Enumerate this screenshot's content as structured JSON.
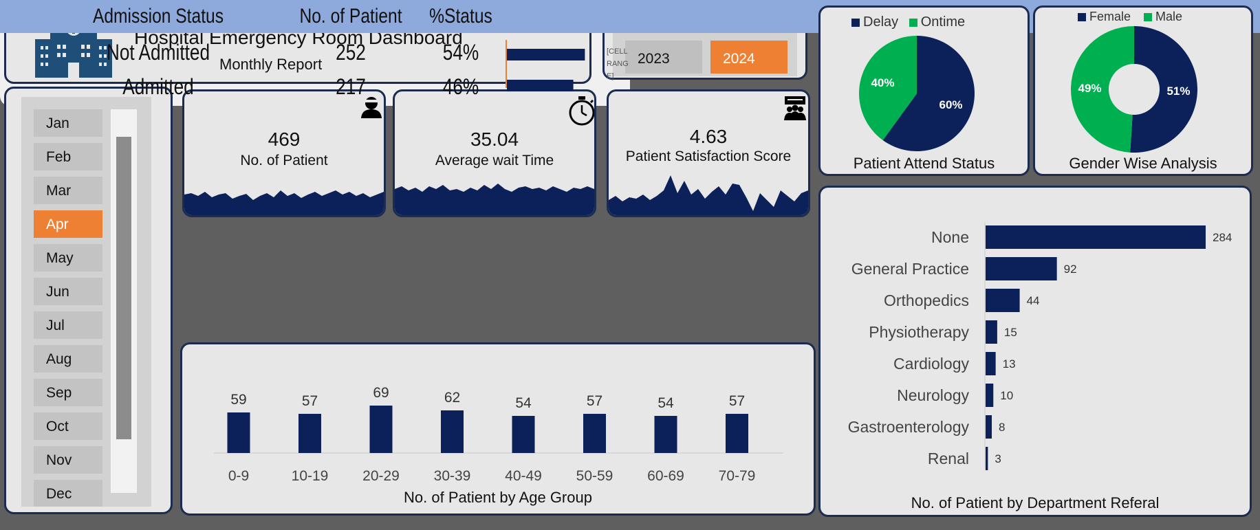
{
  "header": {
    "title": "Hospital Emergency Room Dashboard",
    "subtitle": "Monthly Report",
    "logo_icon": "hospital-icon"
  },
  "years": [
    {
      "label": "2023",
      "selected": false
    },
    {
      "label": "2024",
      "selected": true
    }
  ],
  "months": [
    {
      "label": "Jan",
      "selected": false
    },
    {
      "label": "Feb",
      "selected": false
    },
    {
      "label": "Mar",
      "selected": false
    },
    {
      "label": "Apr",
      "selected": true
    },
    {
      "label": "May",
      "selected": false
    },
    {
      "label": "Jun",
      "selected": false
    },
    {
      "label": "Jul",
      "selected": false
    },
    {
      "label": "Aug",
      "selected": false
    },
    {
      "label": "Sep",
      "selected": false
    },
    {
      "label": "Oct",
      "selected": false
    },
    {
      "label": "Nov",
      "selected": false
    },
    {
      "label": "Dec",
      "selected": false
    }
  ],
  "kpis": {
    "patients": {
      "value": "469",
      "label": "No. of Patient",
      "icon": "doctor-icon"
    },
    "wait": {
      "value": "35.04",
      "label": "Average wait Time",
      "icon": "stopwatch-icon"
    },
    "satisfaction": {
      "value": "4.63",
      "label": "Patient Satisfaction Score",
      "icon": "group-feedback-icon"
    }
  },
  "admission": {
    "headers": [
      "Admission Status",
      "No. of Patient",
      "%Status"
    ],
    "rows": [
      {
        "status": "Not Admitted",
        "count": "252",
        "pct": "54%",
        "value": 0.54
      },
      {
        "status": "Admitted",
        "count": "217",
        "pct": "46%",
        "value": 0.46
      }
    ],
    "cell_range_label": "[CELLRANGE]"
  },
  "colors": {
    "navy": "#0c2159",
    "orange": "#ee8033",
    "green": "#00b050",
    "header_blue": "#8ea9db"
  },
  "chart_data": [
    {
      "type": "bar",
      "title": "No. of Patient by Age Group",
      "categories": [
        "0-9",
        "10-19",
        "20-29",
        "30-39",
        "40-49",
        "50-59",
        "60-69",
        "70-79"
      ],
      "values": [
        59,
        57,
        69,
        62,
        54,
        57,
        54,
        57
      ]
    },
    {
      "type": "pie",
      "title": "Patient Attend Status",
      "categories": [
        "Delay",
        "Ontime"
      ],
      "values": [
        60,
        40
      ],
      "labels": [
        "60%",
        "40%"
      ],
      "legend": "top"
    },
    {
      "type": "pie",
      "title": "Gender Wise Analysis",
      "categories": [
        "Female",
        "Male"
      ],
      "values": [
        51,
        49
      ],
      "labels": [
        "51%",
        "49%"
      ],
      "legend": "top"
    },
    {
      "type": "bar",
      "orientation": "horizontal",
      "title": "No. of Patient by Department Referal",
      "categories": [
        "None",
        "General Practice",
        "Orthopedics",
        "Physiotherapy",
        "Cardiology",
        "Neurology",
        "Gastroenterology",
        "Renal"
      ],
      "values": [
        284,
        92,
        44,
        15,
        13,
        10,
        8,
        3
      ]
    }
  ]
}
